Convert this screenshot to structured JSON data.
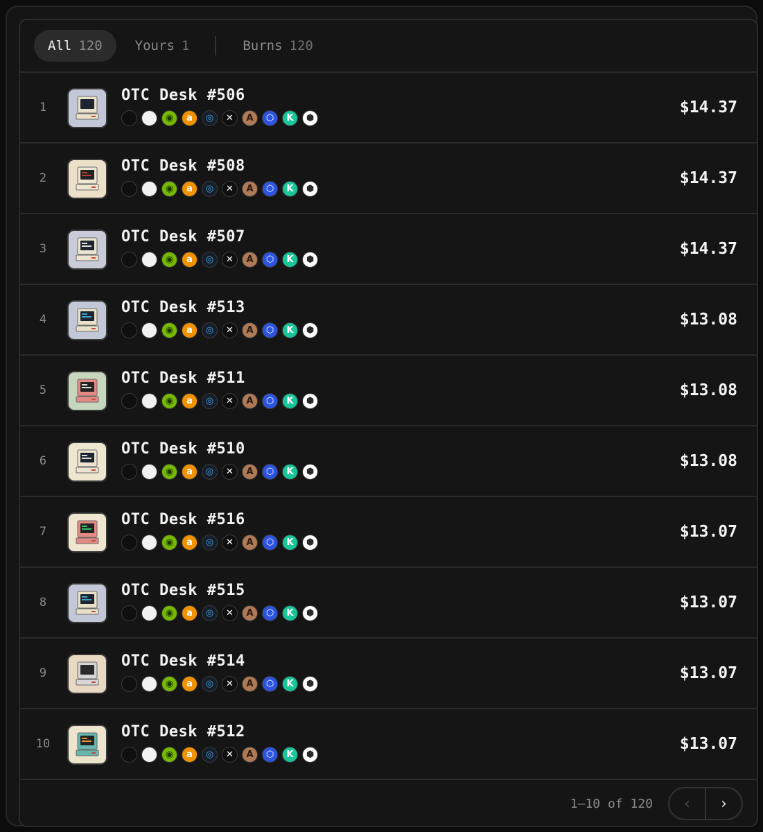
{
  "tabs": [
    {
      "label": "All",
      "count": "120",
      "active": true
    },
    {
      "label": "Yours",
      "count": "1",
      "active": false
    },
    {
      "label": "Burns",
      "count": "120",
      "active": false
    }
  ],
  "badges": [
    {
      "icon": "apple-icon",
      "glyph": "",
      "bg": "#0f0f0f",
      "fg": "#ffffff"
    },
    {
      "icon": "microsoft-icon",
      "glyph": "",
      "bg": "#f2f2f2",
      "fg": "#000000"
    },
    {
      "icon": "nvidia-icon",
      "glyph": "◉",
      "bg": "#76b900",
      "fg": "#1b3a00"
    },
    {
      "icon": "amazon-icon",
      "glyph": "a",
      "bg": "#f29200",
      "fg": "#ffffff"
    },
    {
      "icon": "ring-icon",
      "glyph": "◎",
      "bg": "#161e2a",
      "fg": "#4aa3df"
    },
    {
      "icon": "x-icon",
      "glyph": "✕",
      "bg": "#0f0f0f",
      "fg": "#ffffff"
    },
    {
      "icon": "ai-token-icon",
      "glyph": "A",
      "bg": "#b07a56",
      "fg": "#2a1a10"
    },
    {
      "icon": "blue-hex-icon",
      "glyph": "⬡",
      "bg": "#2d54e0",
      "fg": "#ffffff"
    },
    {
      "icon": "k-token-icon",
      "glyph": "K",
      "bg": "#18c69a",
      "fg": "#ffffff"
    },
    {
      "icon": "white-hex-icon",
      "glyph": "⬢",
      "bg": "#ffffff",
      "fg": "#2a2a2a"
    }
  ],
  "rows": [
    {
      "rank": "1",
      "name": "OTC Desk #506",
      "price": "$14.37",
      "bg": "#c3c8d8",
      "body": "#e8e0c8",
      "screen": "#1f2530",
      "text": "#1f2530"
    },
    {
      "rank": "2",
      "name": "OTC Desk #508",
      "price": "$14.37",
      "bg": "#ece0c8",
      "body": "#efe6d0",
      "screen": "#222",
      "text": "#b83a3a"
    },
    {
      "rank": "3",
      "name": "OTC Desk #507",
      "price": "$14.37",
      "bg": "#c9cbd8",
      "body": "#ece4d0",
      "screen": "#1f2530",
      "text": "#dcdcdc"
    },
    {
      "rank": "4",
      "name": "OTC Desk #513",
      "price": "$13.08",
      "bg": "#c3c8d8",
      "body": "#e8e0c8",
      "screen": "#1f2530",
      "text": "#3fa5c7"
    },
    {
      "rank": "5",
      "name": "OTC Desk #511",
      "price": "$13.08",
      "bg": "#c6d7bd",
      "body": "#e48a84",
      "screen": "#232323",
      "text": "#dddddd"
    },
    {
      "rank": "6",
      "name": "OTC Desk #510",
      "price": "$13.08",
      "bg": "#efe6cf",
      "body": "#ece4d0",
      "screen": "#1f2530",
      "text": "#dcdcdc"
    },
    {
      "rank": "7",
      "name": "OTC Desk #516",
      "price": "$13.07",
      "bg": "#efe6cf",
      "body": "#e48a84",
      "screen": "#232323",
      "text": "#37c06a"
    },
    {
      "rank": "8",
      "name": "OTC Desk #515",
      "price": "$13.07",
      "bg": "#c3c8d8",
      "body": "#e8e0c8",
      "screen": "#1f2530",
      "text": "#3fa5c7"
    },
    {
      "rank": "9",
      "name": "OTC Desk #514",
      "price": "$13.07",
      "bg": "#e9d8c2",
      "body": "#d6d6d6",
      "screen": "#2a2a2a",
      "text": "#2a2a2a"
    },
    {
      "rank": "10",
      "name": "OTC Desk #512",
      "price": "$13.07",
      "bg": "#ece4cc",
      "body": "#66b7ad",
      "screen": "#232323",
      "text": "#e8943a"
    }
  ],
  "pagination": {
    "label": "1–10 of 120",
    "prev_icon": "chevron-left-icon",
    "next_icon": "chevron-right-icon"
  }
}
